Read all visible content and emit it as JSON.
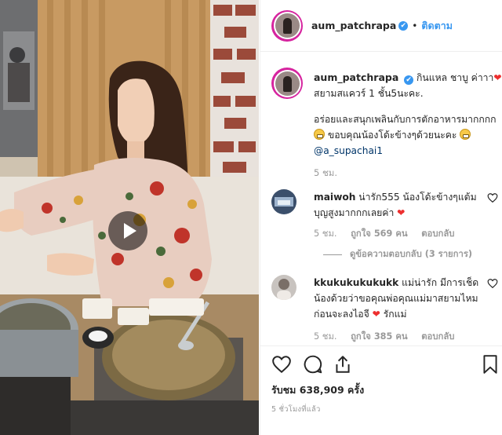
{
  "post": {
    "username": "aum_patchrapa",
    "verified_mark": "✔",
    "separator": "•",
    "follow_label": "ติดตาม"
  },
  "caption": {
    "username": "aum_patchrapa",
    "line1": "กินแหล ชาบู ค่าาา",
    "line1_end": "สยามสแควร์ 1 ชั้น5นะคะ.",
    "line2": "อร่อยและสนุกเพลินกับการตักอาหารมากกกก",
    "line2_b": "ขอบคุณน้องโด้ะข้างๆด้วยนะคะ",
    "mention": "@a_supachai1",
    "timestamp": "5 ชม."
  },
  "comments": [
    {
      "username": "maiwoh",
      "text": "น่ารัก555 น้องโด้ะข้างๆแต้มบุญสูงมากกกเลยค่า",
      "time": "5 ชม.",
      "likes": "ถูกใจ 569 คน",
      "reply": "ตอบกลับ",
      "view_replies": "ดูข้อความตอบกลับ (3 รายการ)"
    },
    {
      "username": "kkukukukukukk",
      "text": "แม่น่ารัก มีการเช็ดน้องด้วยว่าขอคุณพ่อคุณแม่มาสยามไหมก่อนจะลงไอจี",
      "text_end": "รักแม่",
      "time": "5 ชม.",
      "likes": "ถูกใจ 385 คน",
      "reply": "ตอบกลับ"
    }
  ],
  "stats": {
    "views": "รับชม 638,909 ครั้ง",
    "time_ago": "5 ชั่วโมงที่แล้ว"
  },
  "icons": {
    "like": "heart-icon",
    "comment": "comment-icon",
    "share": "share-icon",
    "save": "bookmark-icon",
    "play": "play-icon"
  },
  "colors": {
    "accent": "#3897f0",
    "heart": "#ed2f2f",
    "muted": "#999999",
    "ring": "#d6249f"
  }
}
